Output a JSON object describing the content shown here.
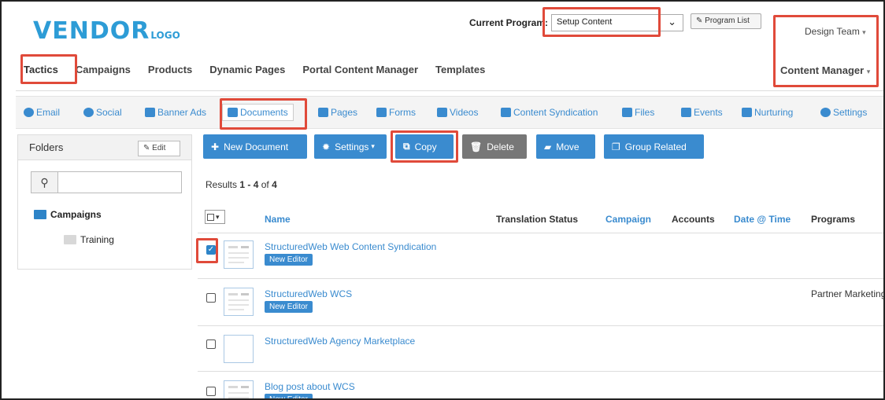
{
  "logo": {
    "main": "VENDOR",
    "sub": "LOGO"
  },
  "program": {
    "label": "Current Program:",
    "value": "Setup Content",
    "list_button": "Program List"
  },
  "team_select": "Design Team",
  "content_manager_select": "Content Manager",
  "nav": [
    "Tactics",
    "Campaigns",
    "Products",
    "Dynamic Pages",
    "Portal Content Manager",
    "Templates"
  ],
  "tabs": [
    {
      "label": "Email",
      "icon": "wifi-icon"
    },
    {
      "label": "Social",
      "icon": "speech-bubble-icon"
    },
    {
      "label": "Banner Ads",
      "icon": "banner-icon"
    },
    {
      "label": "Documents",
      "icon": "pdf-icon"
    },
    {
      "label": "Pages",
      "icon": "page-icon"
    },
    {
      "label": "Forms",
      "icon": "form-icon"
    },
    {
      "label": "Videos",
      "icon": "video-icon"
    },
    {
      "label": "Content Syndication",
      "icon": "syndication-icon"
    },
    {
      "label": "Files",
      "icon": "file-icon"
    },
    {
      "label": "Events",
      "icon": "calendar-icon"
    },
    {
      "label": "Nurturing",
      "icon": "bars-icon"
    },
    {
      "label": "Settings",
      "icon": "gear-icon"
    }
  ],
  "folders": {
    "title": "Folders",
    "edit_label": "Edit",
    "search_value": "",
    "items": [
      {
        "label": "Campaigns"
      },
      {
        "label": "Training"
      }
    ]
  },
  "toolbar": {
    "new_document": "New Document",
    "settings": "Settings",
    "copy": "Copy",
    "delete": "Delete",
    "move": "Move",
    "group_related": "Group Related"
  },
  "results": {
    "prefix": "Results",
    "range": "1 - 4",
    "of": "of",
    "total": "4"
  },
  "table": {
    "headers": [
      "Name",
      "Translation Status",
      "Campaign",
      "Accounts",
      "Date @ Time",
      "Programs"
    ],
    "rows": [
      {
        "name": "StructuredWeb Web Content Syndication",
        "badge": "New Editor",
        "program": "",
        "checked": true
      },
      {
        "name": "StructuredWeb WCS",
        "badge": "New Editor",
        "program": "Partner Marketing",
        "checked": false
      },
      {
        "name": "StructuredWeb Agency Marketplace",
        "badge": "",
        "program": "",
        "checked": false
      },
      {
        "name": "Blog post about WCS",
        "badge": "New Editor",
        "program": "",
        "checked": false
      }
    ]
  },
  "colors": {
    "accent": "#3a8bcf",
    "highlight": "#e04a3a",
    "logo": "#2d9cd6"
  }
}
